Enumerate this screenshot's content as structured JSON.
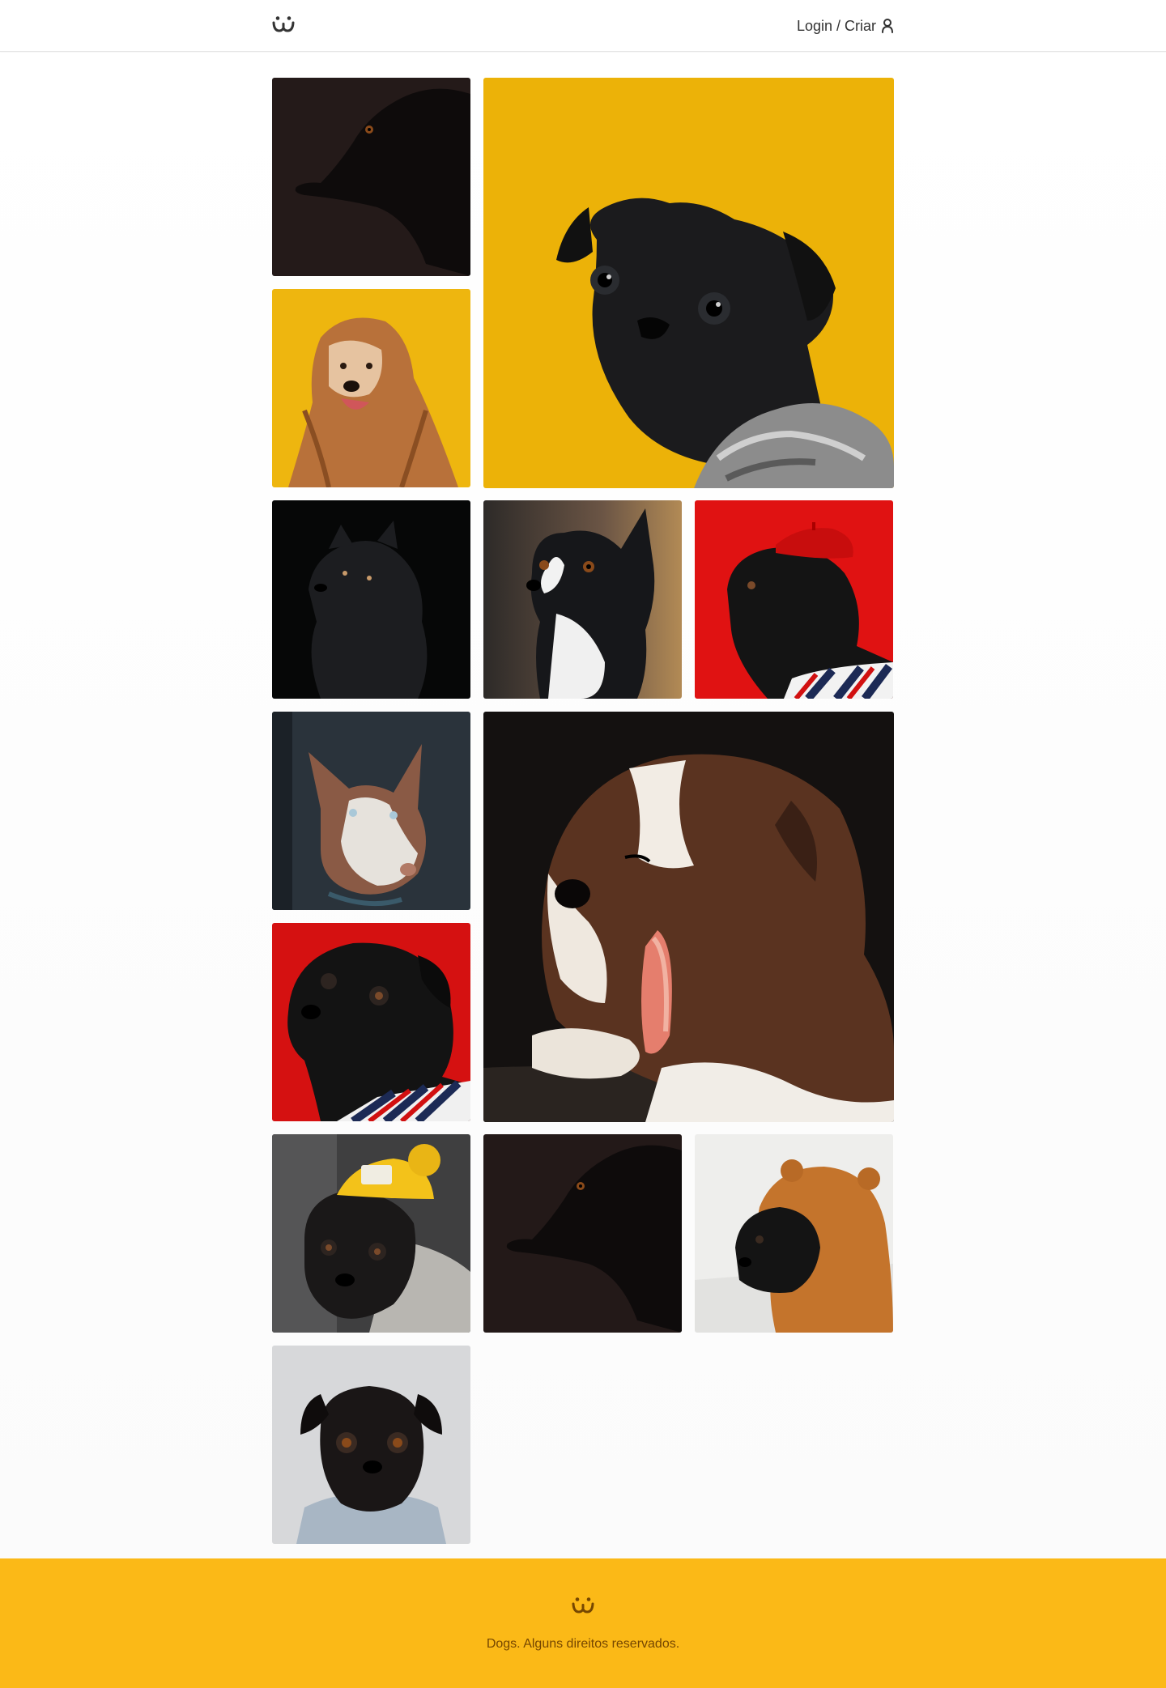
{
  "header": {
    "logo": {
      "icon": "dog-face-logo-icon",
      "color": "#333333"
    },
    "login_label": "Login / Criar",
    "user_icon": "user-icon"
  },
  "feed": {
    "photos": [
      {
        "id": "photo-1",
        "subject": "black dog in shadow",
        "background_color": "#241a19",
        "dog_color": "#0e0b0b"
      },
      {
        "id": "photo-2",
        "subject": "black pug in knitted scarf",
        "background_color": "#ecb208",
        "dog_color": "#1b1b1d"
      },
      {
        "id": "photo-3",
        "subject": "afghan hound",
        "background_color": "#eeb60f",
        "dog_color": "#b8713a"
      },
      {
        "id": "photo-4",
        "subject": "black fluffy dog",
        "background_color": "#060707",
        "dog_color": "#1c1d20"
      },
      {
        "id": "photo-5",
        "subject": "boston terrier",
        "background_color": "#5c4a3f",
        "dog_color": "#16171a"
      },
      {
        "id": "photo-6",
        "subject": "pug with red beret",
        "background_color": "#e01212",
        "dog_color": "#141414"
      },
      {
        "id": "photo-7",
        "subject": "husky",
        "background_color": "#2a333b",
        "dog_color": "#c9c1b8"
      },
      {
        "id": "photo-8",
        "subject": "yawning puppy",
        "background_color": "#141110",
        "dog_color": "#5a3320"
      },
      {
        "id": "photo-9",
        "subject": "pug with striped shirt",
        "background_color": "#d51111",
        "dog_color": "#131313"
      },
      {
        "id": "photo-10",
        "subject": "pug with yellow beanie",
        "background_color": "#3f3f40",
        "dog_color": "#1a1818"
      },
      {
        "id": "photo-11",
        "subject": "black dog in shadow",
        "background_color": "#231918",
        "dog_color": "#0e0b0b"
      },
      {
        "id": "photo-12",
        "subject": "pug in bear hoodie",
        "background_color": "#eeeeec",
        "dog_color": "#141414"
      },
      {
        "id": "photo-13",
        "subject": "pug in denim jacket",
        "background_color": "#d7d8da",
        "dog_color": "#1a1616"
      }
    ]
  },
  "footer": {
    "logo": {
      "icon": "dog-face-logo-icon",
      "color": "#764701"
    },
    "text": "Dogs. Alguns direitos reservados.",
    "background": "#fbb917"
  }
}
